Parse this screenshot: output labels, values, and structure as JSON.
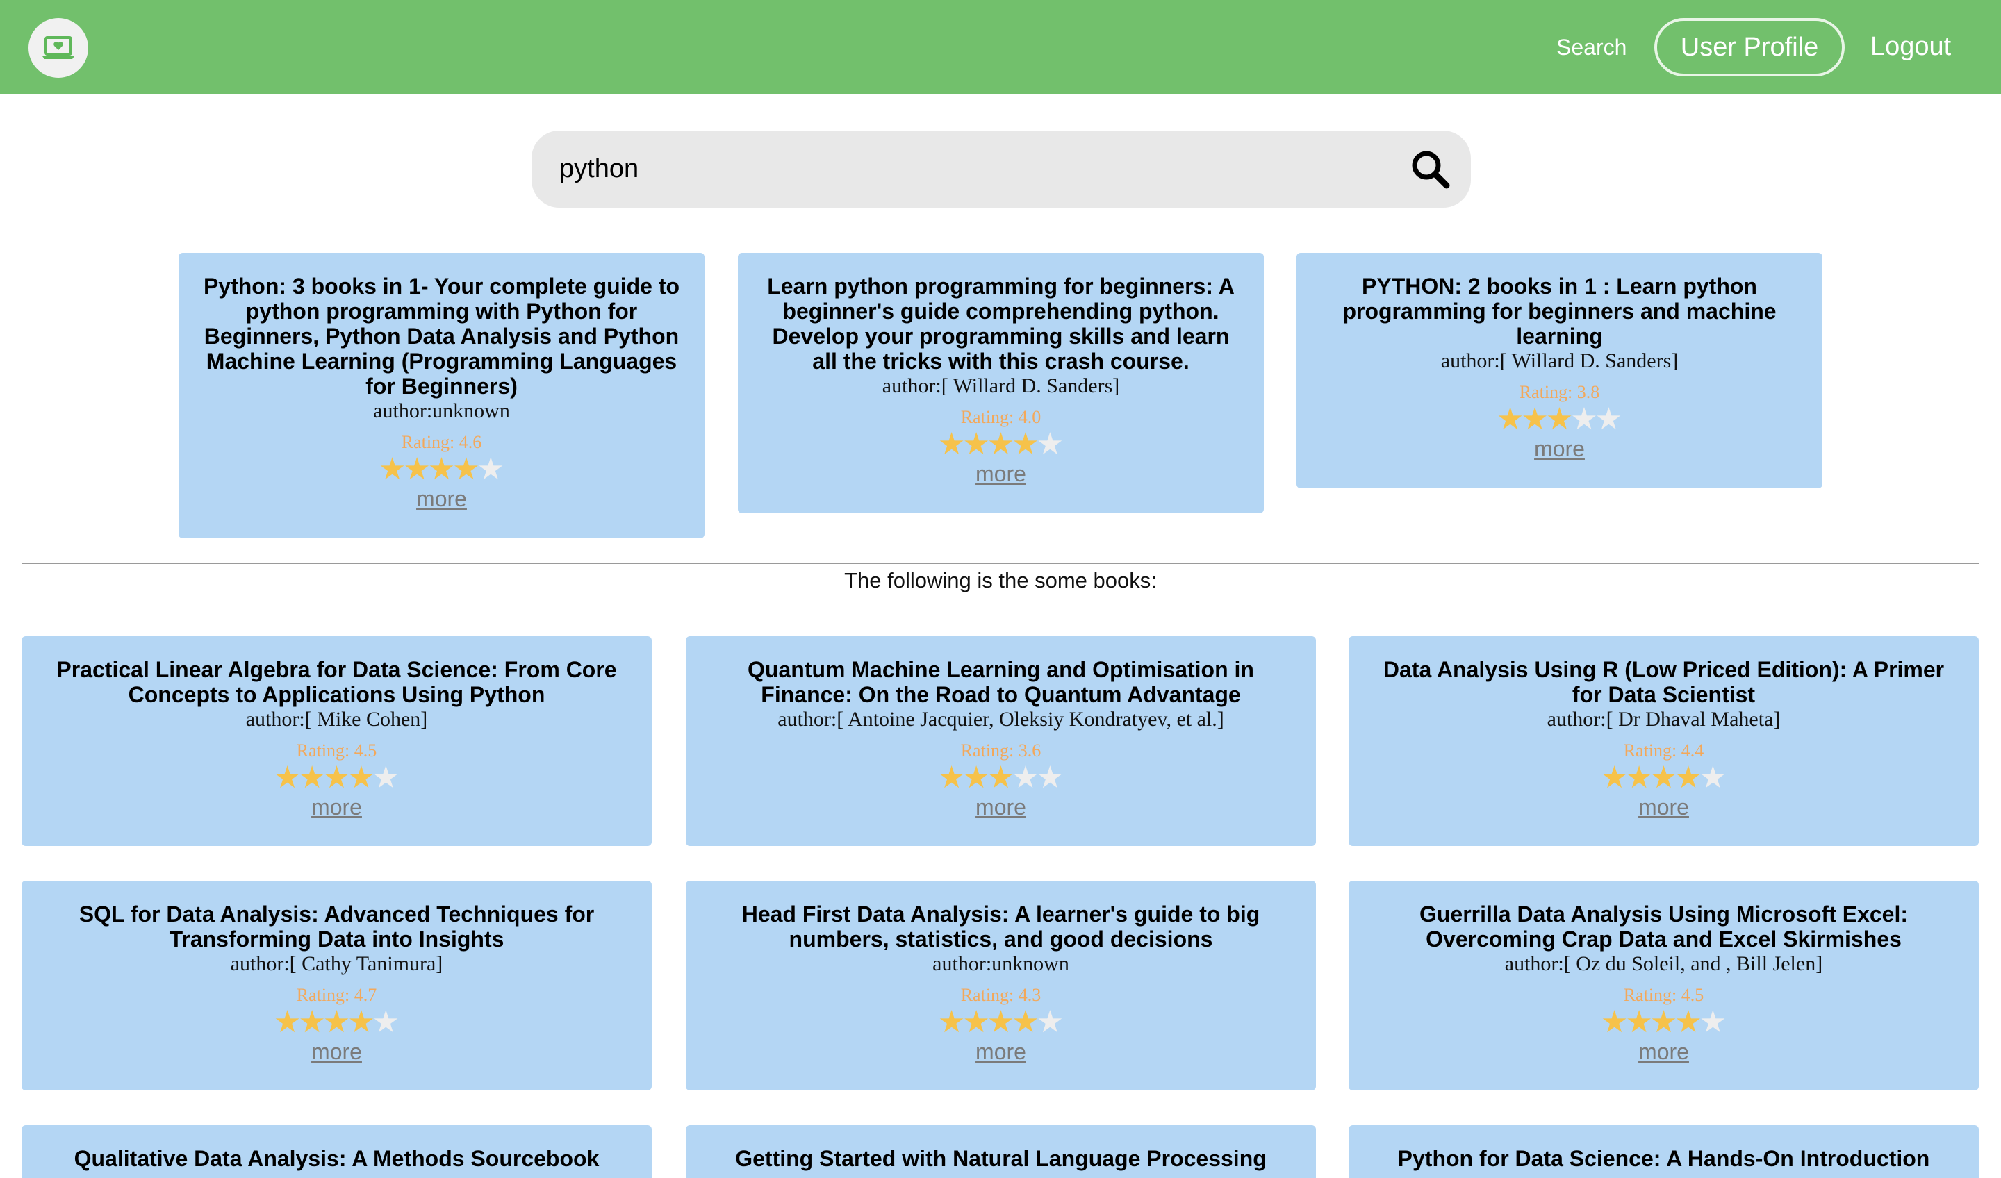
{
  "header": {
    "nav_search": "Search",
    "nav_profile": "User Profile",
    "nav_logout": "Logout",
    "logo_icon": "laptop-heart-icon",
    "colors": {
      "navbar": "#72c06c"
    }
  },
  "search": {
    "value": "python",
    "button_icon": "search-icon"
  },
  "featured": [
    {
      "title": "Python: 3 books in 1- Your complete guide to python programming with Python for Beginners, Python Data Analysis and Python Machine Learning (Programming Languages for Beginners)",
      "author": "author:unknown",
      "rating_label": "Rating: 4.6",
      "rating": 4.6,
      "more": "more"
    },
    {
      "title": "Learn python programming for beginners: A beginner's guide comprehending python. Develop your programming skills and learn all the tricks with this crash course.",
      "author": "author:[ Willard D. Sanders]",
      "rating_label": "Rating: 4.0",
      "rating": 4.0,
      "more": "more"
    },
    {
      "title": "PYTHON: 2 books in 1 : Learn python programming for beginners and machine learning",
      "author": "author:[ Willard D. Sanders]",
      "rating_label": "Rating: 3.8",
      "rating": 3.8,
      "more": "more"
    }
  ],
  "section_caption": "The following is the some books:",
  "books": [
    {
      "title": "Practical Linear Algebra for Data Science: From Core Concepts to Applications Using Python",
      "author": "author:[ Mike Cohen]",
      "rating_label": "Rating: 4.5",
      "rating": 4.5,
      "more": "more"
    },
    {
      "title": "Quantum Machine Learning and Optimisation in Finance: On the Road to Quantum Advantage",
      "author": "author:[ Antoine Jacquier, Oleksiy Kondratyev, et al.]",
      "rating_label": "Rating: 3.6",
      "rating": 3.6,
      "more": "more"
    },
    {
      "title": "Data Analysis Using R (Low Priced Edition): A Primer for Data Scientist",
      "author": "author:[ Dr Dhaval Maheta]",
      "rating_label": "Rating: 4.4",
      "rating": 4.4,
      "more": "more"
    },
    {
      "title": "SQL for Data Analysis: Advanced Techniques for Transforming Data into Insights",
      "author": "author:[ Cathy Tanimura]",
      "rating_label": "Rating: 4.7",
      "rating": 4.7,
      "more": "more"
    },
    {
      "title": "Head First Data Analysis: A learner's guide to big numbers, statistics, and good decisions",
      "author": "author:unknown",
      "rating_label": "Rating: 4.3",
      "rating": 4.3,
      "more": "more"
    },
    {
      "title": "Guerrilla Data Analysis Using Microsoft Excel: Overcoming Crap Data and Excel Skirmishes",
      "author": "author:[ Oz du Soleil, and , Bill Jelen]",
      "rating_label": "Rating: 4.5",
      "rating": 4.5,
      "more": "more"
    },
    {
      "title": "Qualitative Data Analysis: A Methods Sourcebook",
      "author": "",
      "rating_label": "",
      "rating": null,
      "more": ""
    },
    {
      "title": "Getting Started with Natural Language Processing",
      "author": "",
      "rating_label": "",
      "rating": null,
      "more": ""
    },
    {
      "title": "Python for Data Science: A Hands-On Introduction",
      "author": "",
      "rating_label": "",
      "rating": null,
      "more": ""
    }
  ],
  "colors": {
    "card": "#b4d6f4",
    "star_on": "#f6c24a",
    "star_off": "#eeeeee",
    "rating_text": "#f3a85a"
  }
}
